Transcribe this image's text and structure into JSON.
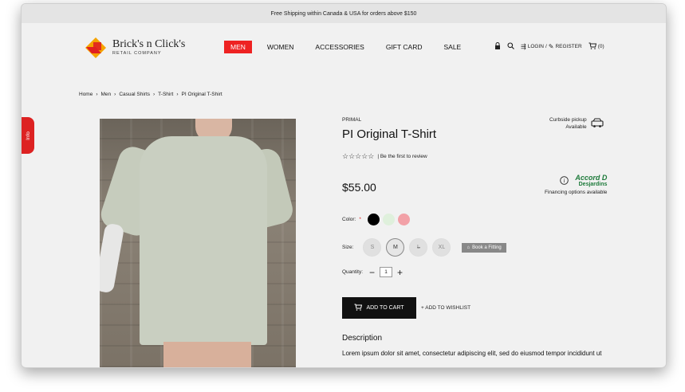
{
  "promo": "Free Shipping within Canada & USA for orders above $150",
  "logo": {
    "name": "Brick's n Click's",
    "sub": "RETAIL COMPANY"
  },
  "nav": [
    "MEN",
    "WOMEN",
    "ACCESSORIES",
    "GIFT CARD",
    "SALE"
  ],
  "util": {
    "login": "LOGIN",
    "sep": "/",
    "register": "REGISTER",
    "cart_count": "(0)"
  },
  "breadcrumb": [
    "Home",
    "Men",
    "Casual Shirts",
    "T-Shirt",
    "PI Original T-Shirt"
  ],
  "info_tab": "Info",
  "product": {
    "brand": "PRIMAL",
    "title": "PI Original T-Shirt",
    "stars": "☆☆☆☆☆",
    "review_text": "| Be the first to review",
    "price": "$55.00",
    "curbside": [
      "Curbside pickup",
      "Available"
    ],
    "accord": {
      "logo": "Accord D",
      "sub": "Desjardins",
      "note": "Financing options available"
    },
    "color_label": "Color:",
    "required_mark": "*",
    "colors": [
      "#000000",
      "#dff0dc",
      "#f2a1a7"
    ],
    "size_label": "Size:",
    "sizes": [
      "S",
      "M",
      "L",
      "XL"
    ],
    "fitting_label": "Book a Fitting",
    "qty_label": "Quantity:",
    "qty_minus": "−",
    "qty_plus": "+",
    "qty": "1",
    "add_cart": "ADD TO CART",
    "wishlist": "+ ADD TO WISHLIST",
    "desc_title": "Description",
    "desc_text": "Lorem ipsum dolor sit amet, consectetur adipiscing elit, sed do eiusmod tempor incididunt ut"
  }
}
